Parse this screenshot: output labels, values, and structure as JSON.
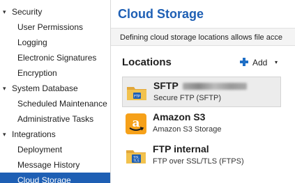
{
  "sidebar": {
    "items": [
      {
        "label": "Security",
        "type": "group"
      },
      {
        "label": "User Permissions",
        "type": "child"
      },
      {
        "label": "Logging",
        "type": "child"
      },
      {
        "label": "Electronic Signatures",
        "type": "child"
      },
      {
        "label": "Encryption",
        "type": "child"
      },
      {
        "label": "System Database",
        "type": "group"
      },
      {
        "label": "Scheduled Maintenance",
        "type": "child"
      },
      {
        "label": "Administrative Tasks",
        "type": "child"
      },
      {
        "label": "Integrations",
        "type": "group"
      },
      {
        "label": "Deployment",
        "type": "child"
      },
      {
        "label": "Message History",
        "type": "child"
      },
      {
        "label": "Cloud Storage",
        "type": "child",
        "selected": true
      }
    ],
    "expand_glyph": "▾"
  },
  "main": {
    "title": "Cloud Storage",
    "description": "Defining cloud storage locations allows file acce",
    "locations_heading": "Locations",
    "add_label": "Add",
    "add_dropdown_glyph": "▾",
    "locations": [
      {
        "name": "SFTP",
        "subtitle": "Secure FTP (SFTP)",
        "icon": "sftp-folder-icon",
        "redacted": true,
        "selected": true
      },
      {
        "name": "Amazon S3",
        "subtitle": "Amazon S3 Storage",
        "icon": "amazon-s3-icon",
        "selected": false
      },
      {
        "name": "FTP internal",
        "subtitle": "FTP over SSL/TLS (FTPS)",
        "icon": "ftps-folder-icon",
        "selected": false
      }
    ]
  },
  "colors": {
    "accent": "#1e5fb4",
    "add_plus": "#1f6fc6",
    "amazon_orange": "#f6a11a",
    "folder_yellow": "#f2c24e"
  },
  "icon_text": {
    "sftp": "FTP",
    "ssl": "SSL",
    "tls": "TLS"
  }
}
